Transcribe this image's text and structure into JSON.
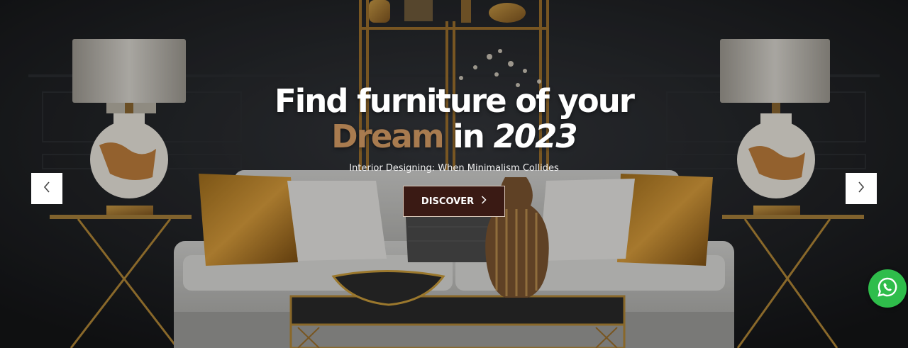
{
  "hero": {
    "headline_line1": "Find furniture of your",
    "headline_accent": "Dream",
    "headline_in": "in",
    "headline_year": "2023",
    "subtitle": "Interior Designing: When Minimalism Collides",
    "cta_label": "DISCOVER",
    "cta_icon": "chevron-right-icon",
    "accent_color": "#a87b4f",
    "cta_background": "#3a1a14"
  },
  "slider": {
    "prev_icon": "chevron-left-icon",
    "next_icon": "chevron-right-icon"
  },
  "floating": {
    "whatsapp_icon": "whatsapp-icon",
    "whatsapp_color": "#2fbd4b"
  }
}
